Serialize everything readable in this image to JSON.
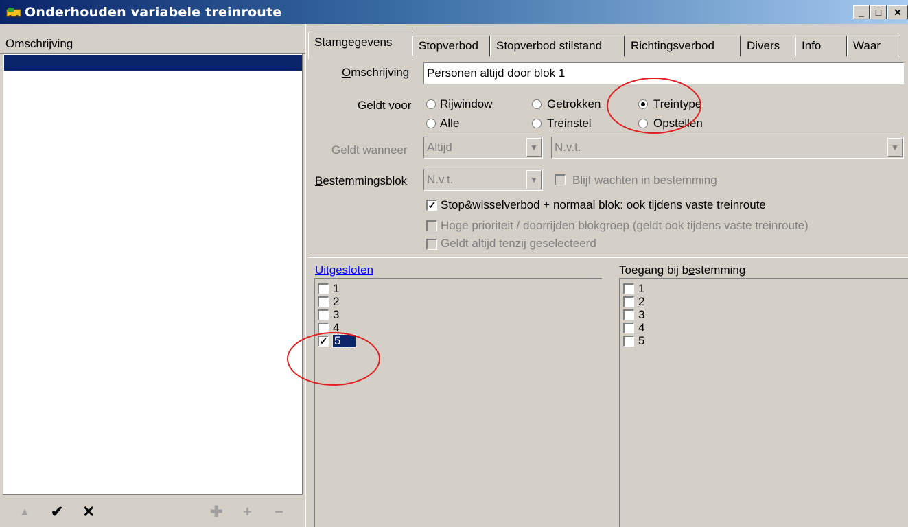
{
  "window": {
    "title": "Onderhouden variabele treinroute"
  },
  "left": {
    "column_header": "Omschrijving",
    "toolbar": [
      "up-icon",
      "check-icon",
      "cross-icon",
      "add-all-icon",
      "add-icon",
      "remove-icon"
    ]
  },
  "tabs": [
    "Stamgegevens",
    "Stopverbod",
    "Stopverbod stilstand",
    "Richtingsverbod",
    "Divers",
    "Info",
    "Waar"
  ],
  "form": {
    "omschrijving_label": "Omschrijving",
    "omschrijving_value": "Personen altijd door blok 1",
    "geldt_voor_label": "Geldt voor",
    "radios": [
      "Rijwindow",
      "Getrokken",
      "Treintype",
      "Alle",
      "Treinstel",
      "Opstellen"
    ],
    "selected_radio": "Treintype",
    "geldt_wanneer_label": "Geldt wanneer",
    "geldt_wanneer_value": "Altijd",
    "geldt_wanneer_value2": "N.v.t.",
    "bestemmingsblok_label": "Bestemmingsblok",
    "bestemmingsblok_value": "N.v.t.",
    "blijf_wachten": "Blijf wachten in bestemming",
    "stop_wissel": "Stop&wisselverbod + normaal blok: ook tijdens vaste treinroute",
    "hoge_prioriteit": "Hoge prioriteit / doorrijden blokgroep (geldt ook tijdens vaste treinroute)",
    "geldt_altijd": "Geldt altijd tenzij geselecteerd"
  },
  "uitgesloten": {
    "label": "Uitgesloten",
    "items": [
      "1",
      "2",
      "3",
      "4",
      "5"
    ],
    "checked": [
      "5"
    ]
  },
  "toegang": {
    "label": "Toegang bij bestemming",
    "items": [
      "1",
      "2",
      "3",
      "4",
      "5"
    ]
  },
  "colors": {
    "titlebar": "#0a246a",
    "selection": "#0a246a",
    "annotation": "#e02020",
    "link": "#0000ff"
  }
}
